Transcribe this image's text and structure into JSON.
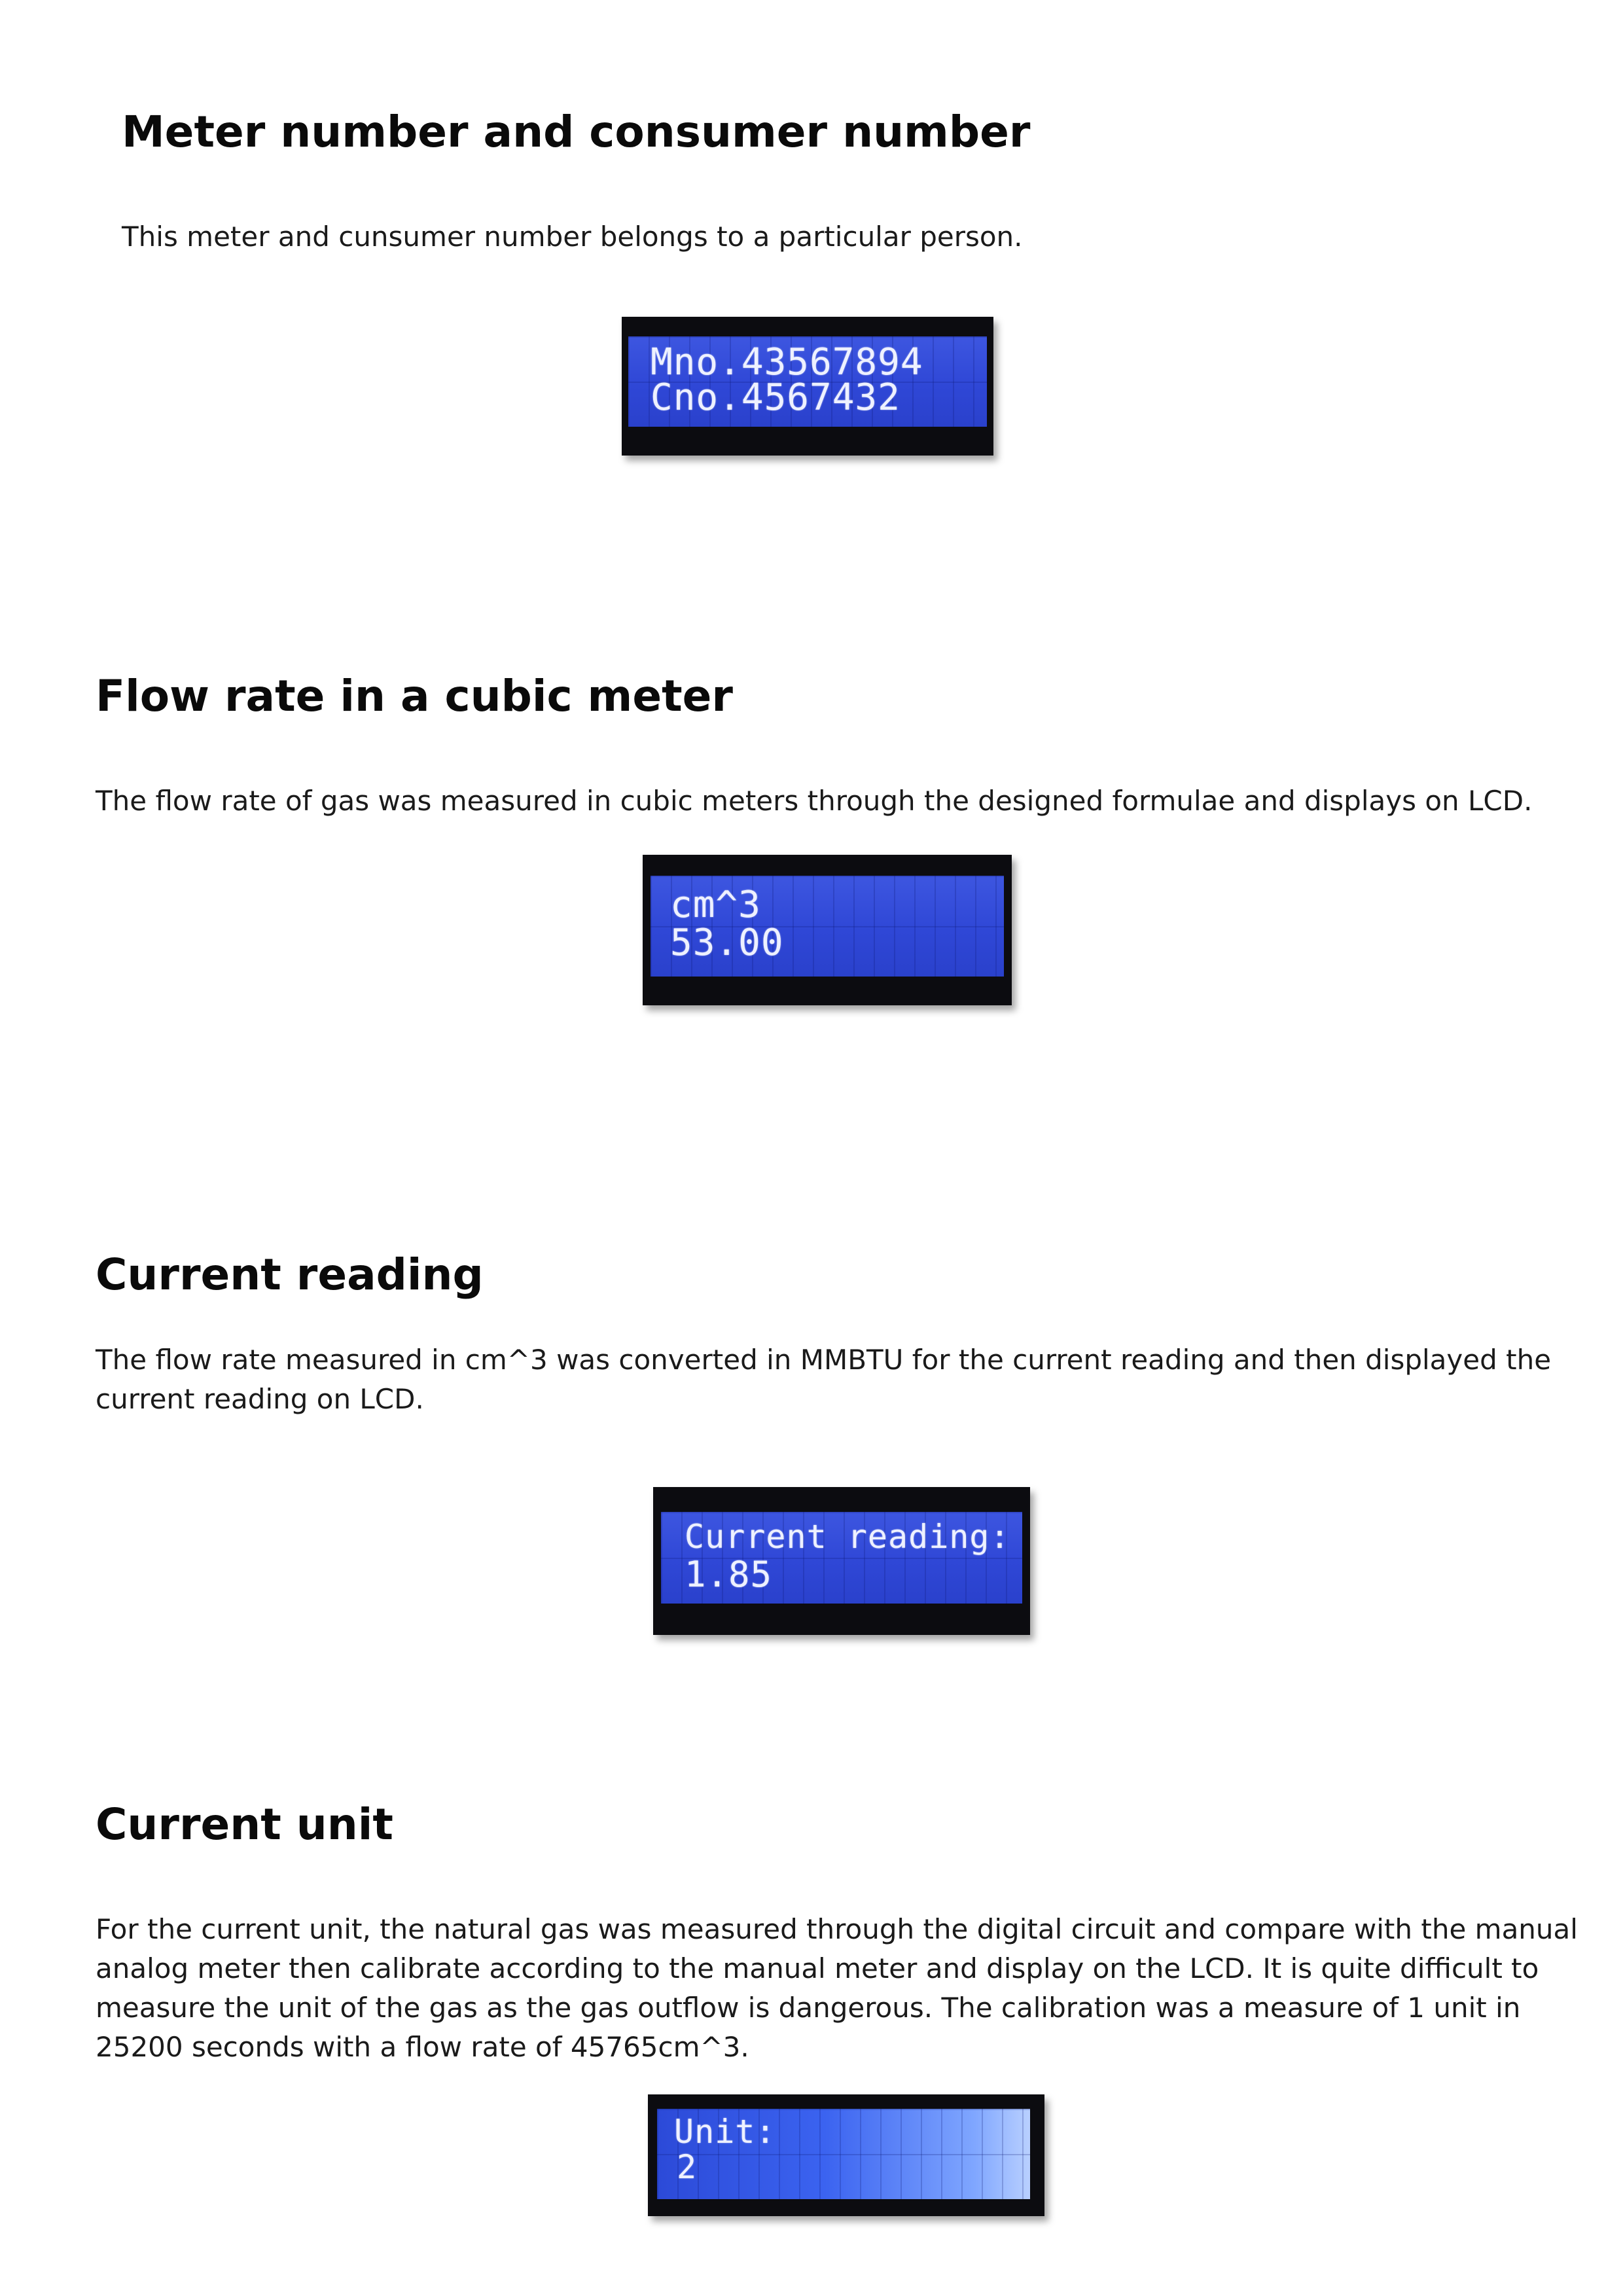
{
  "sections": [
    {
      "title": "Meter number and consumer number",
      "text": "This meter and cunsumer number belongs to a particular person.",
      "lcd": {
        "line1": "Mno.43567894",
        "line2": "Cno.4567432"
      }
    },
    {
      "title": "Flow rate in a cubic meter",
      "text": "The flow rate of gas was measured in cubic meters through the designed formulae and displays on LCD.",
      "lcd": {
        "line1": "cm^3",
        "line2": "53.00"
      }
    },
    {
      "title": "Current reading",
      "text": "The flow rate measured in cm^3 was converted in MMBTU for the current reading and then displayed the current reading on LCD.",
      "lcd": {
        "line1": "Current reading:",
        "line2": "1.85"
      }
    },
    {
      "title": "Current unit",
      "text": "For the current unit, the natural gas was measured through the digital circuit and compare with the manual analog meter then calibrate according to the manual meter and display on the LCD. It is quite difficult to measure the unit of the gas as the gas outflow is dangerous. The calibration was a measure of 1 unit in 25200 seconds with a flow rate of 45765cm^3.",
      "lcd": {
        "line1": "Unit:",
        "line2": "2"
      }
    }
  ],
  "colors": {
    "lcd_blue": "#3049d8",
    "lcd_text": "#eef1ff",
    "bezel": "#0c0c10"
  }
}
